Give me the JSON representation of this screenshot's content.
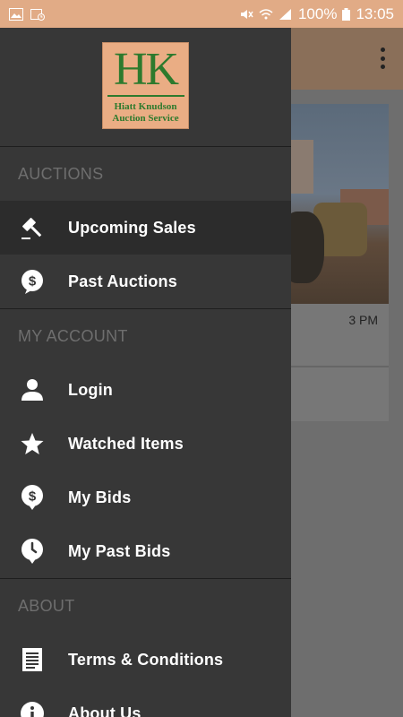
{
  "status_bar": {
    "battery": "100%",
    "time": "13:05"
  },
  "background": {
    "card_time": "3 PM"
  },
  "drawer": {
    "logo": {
      "letters": "HK",
      "line1": "Hiatt Knudson",
      "line2": "Auction Service"
    },
    "sections": [
      {
        "header": "AUCTIONS",
        "items": [
          {
            "label": "Upcoming Sales",
            "icon": "gavel-icon",
            "selected": true
          },
          {
            "label": "Past Auctions",
            "icon": "dollar-bubble-icon",
            "selected": false
          }
        ]
      },
      {
        "header": "MY ACCOUNT",
        "items": [
          {
            "label": "Login",
            "icon": "person-icon"
          },
          {
            "label": "Watched Items",
            "icon": "star-icon"
          },
          {
            "label": "My Bids",
            "icon": "dollar-pin-icon"
          },
          {
            "label": "My Past Bids",
            "icon": "clock-pin-icon"
          }
        ]
      },
      {
        "header": "ABOUT",
        "items": [
          {
            "label": "Terms & Conditions",
            "icon": "document-icon"
          },
          {
            "label": "About Us",
            "icon": "info-icon"
          }
        ]
      }
    ]
  },
  "colors": {
    "status_bar": "#e1ab86",
    "drawer_bg": "#373737",
    "selected_bg": "#2c2c2c",
    "section_header": "#6e6e6e",
    "logo_bg": "#eaad84",
    "logo_green": "#2d7a2d"
  }
}
